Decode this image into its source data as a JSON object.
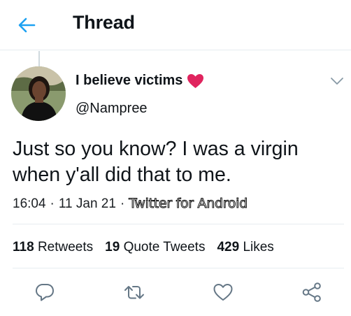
{
  "header": {
    "title": "Thread",
    "back_icon": "arrow-left-icon",
    "accent_color": "#1da1f2"
  },
  "tweet": {
    "author": {
      "display_name": "I believe victims",
      "name_emoji": "red-heart-icon",
      "username": "@Nampree",
      "avatar": "avatar-photo"
    },
    "text": "Just so you know? I was a virgin\nwhen y'all did that to me.",
    "time": "16:04",
    "date": "11 Jan 21",
    "separator": "·",
    "source": "Twitter for Android",
    "stats": {
      "retweets_count": "118",
      "retweets_label": "Retweets",
      "quotes_count": "19",
      "quotes_label": "Quote Tweets",
      "likes_count": "429",
      "likes_label": "Likes"
    }
  },
  "actions": [
    "reply-icon",
    "retweet-icon",
    "like-icon",
    "share-icon"
  ],
  "colors": {
    "icon_gray": "#657786",
    "divider": "#e6ecf0",
    "heart": "#e0245e"
  }
}
